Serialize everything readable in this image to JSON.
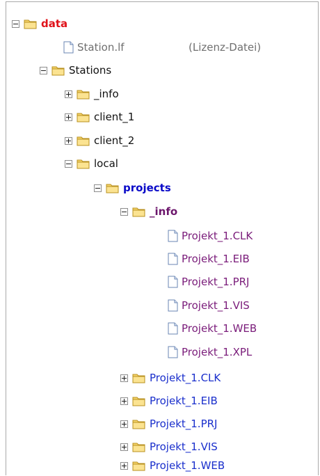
{
  "tree": {
    "root": {
      "label": "data",
      "expanded": true
    },
    "license_file": {
      "label": "Station.lf",
      "note": "(Lizenz-Datei)"
    },
    "stations": {
      "label": "Stations",
      "expanded": true
    },
    "info_folder": {
      "label": "_info",
      "expanded": false
    },
    "client1": {
      "label": "client_1",
      "expanded": false
    },
    "client2": {
      "label": "client_2",
      "expanded": false
    },
    "local": {
      "label": "local",
      "expanded": true
    },
    "projects": {
      "label": "projects",
      "expanded": true
    },
    "projects_info": {
      "label": "_info",
      "expanded": true
    },
    "info_files": [
      "Projekt_1.CLK",
      "Projekt_1.EIB",
      "Projekt_1.PRJ",
      "Projekt_1.VIS",
      "Projekt_1.WEB",
      "Projekt_1.XPL"
    ],
    "project_folders": [
      "Projekt_1.CLK",
      "Projekt_1.EIB",
      "Projekt_1.PRJ",
      "Projekt_1.VIS",
      "Projekt_1.WEB"
    ]
  },
  "colors": {
    "root_label": "#e0131a",
    "projects_label": "#0a0ac8",
    "info_label": "#6c166c",
    "file_label": "#7a1c7a",
    "project_folder_label": "#1a2fcc",
    "folder_fill": "#f5d36a"
  },
  "icons": {
    "folder": "folder-icon",
    "file": "file-icon",
    "toggle": "expand-toggle"
  }
}
